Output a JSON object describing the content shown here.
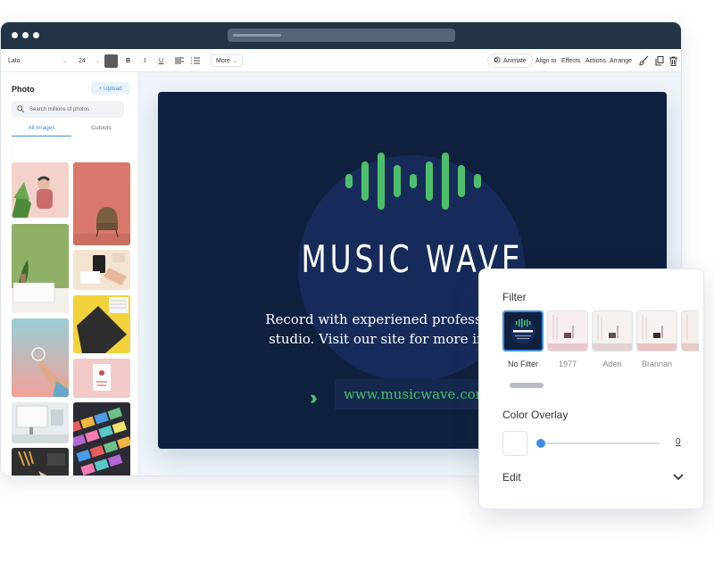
{
  "toolbar": {
    "font_value": "Lato",
    "size_value": "24",
    "bold_label": "B",
    "italic_label": "I",
    "underline_label": "U",
    "more_label": "More",
    "animate_label": "Animate",
    "align_label": "Align to",
    "effects_label": "Effects",
    "actions_label": "Actions",
    "arrange_label": "Arrange"
  },
  "sidebar": {
    "title": "Photo",
    "upload_label": "+ Upload",
    "search_placeholder": "Search millions of photos",
    "tabs": [
      {
        "label": "All Images"
      },
      {
        "label": "Cutouts"
      }
    ],
    "active_tab": "All Images"
  },
  "poster": {
    "title": "MUSIC WAVE",
    "body": "Record with experiened professional in our studio. Visit our site for more information.",
    "url": "www.musicwave.com",
    "background": "#0f1f3e",
    "accent": "#4cbf6b"
  },
  "panel": {
    "filter_heading": "Filter",
    "filters": [
      {
        "label": "No Filter",
        "selected": true
      },
      {
        "label": "1977"
      },
      {
        "label": "Aden"
      },
      {
        "label": "Brannan"
      }
    ],
    "overlay_heading": "Color Overlay",
    "overlay_value": "0",
    "edit_heading": "Edit"
  },
  "colors": {
    "titlebar": "#243447",
    "accent_blue": "#3d8fe3",
    "poster_green": "#4cbf6b"
  }
}
